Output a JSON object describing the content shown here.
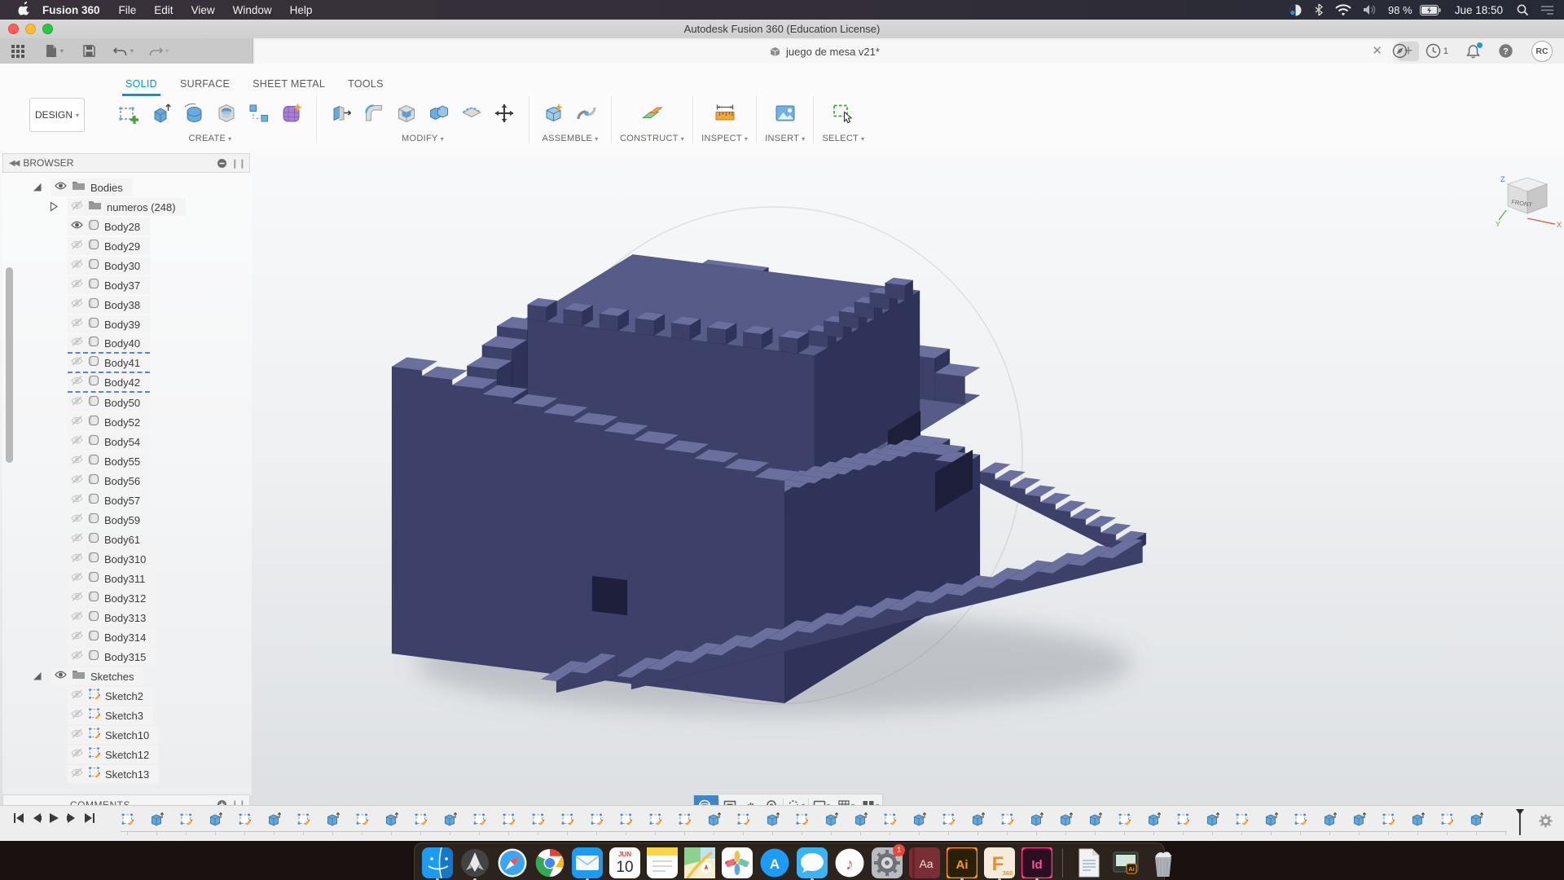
{
  "menu_bar": {
    "app_name": "Fusion 360",
    "items": [
      "File",
      "Edit",
      "View",
      "Window",
      "Help"
    ],
    "status_icons": [
      "display-toggle-icon",
      "bluetooth-icon",
      "wifi-icon",
      "volume-icon"
    ],
    "status": {
      "battery_pct": "98 %",
      "clock": "Jue 18:50"
    },
    "trailing_icons": [
      "spotlight-search-icon",
      "notification-center-icon"
    ]
  },
  "window_title": "Autodesk Fusion 360 (Education License)",
  "document_tab": {
    "title": "juego de mesa v21*"
  },
  "account": {
    "notification_count": "1",
    "avatar_initials": "RC"
  },
  "ribbon": {
    "workspace_label": "DESIGN",
    "tabs": [
      {
        "label": "SOLID",
        "active": true
      },
      {
        "label": "SURFACE",
        "active": false
      },
      {
        "label": "SHEET METAL",
        "active": false
      },
      {
        "label": "TOOLS",
        "active": false
      }
    ],
    "groups": [
      {
        "label": "CREATE",
        "tools": [
          "create-sketch",
          "extrude",
          "revolve",
          "hole",
          "rectangular-pattern",
          "create-form"
        ]
      },
      {
        "label": "MODIFY",
        "tools": [
          "press-pull",
          "fillet",
          "shell",
          "combine",
          "split-body",
          "move-copy"
        ]
      },
      {
        "label": "ASSEMBLE",
        "tools": [
          "new-component",
          "joint"
        ]
      },
      {
        "label": "CONSTRUCT",
        "tools": [
          "construction-plane"
        ]
      },
      {
        "label": "INSPECT",
        "tools": [
          "measure"
        ]
      },
      {
        "label": "INSERT",
        "tools": [
          "insert-image"
        ]
      },
      {
        "label": "SELECT",
        "tools": [
          "select"
        ]
      }
    ]
  },
  "browser": {
    "title": "BROWSER",
    "comments_label": "COMMENTS",
    "tree": [
      {
        "label": "Bodies",
        "type": "folder",
        "level": 1,
        "visible": true,
        "expanded": true
      },
      {
        "label": "numeros (248)",
        "type": "folder",
        "level": 2,
        "visible": false,
        "expanded": false
      },
      {
        "label": "Body28",
        "type": "body",
        "level": 2,
        "visible": true
      },
      {
        "label": "Body29",
        "type": "body",
        "level": 2,
        "visible": false
      },
      {
        "label": "Body30",
        "type": "body",
        "level": 2,
        "visible": false
      },
      {
        "label": "Body37",
        "type": "body",
        "level": 2,
        "visible": false
      },
      {
        "label": "Body38",
        "type": "body",
        "level": 2,
        "visible": false
      },
      {
        "label": "Body39",
        "type": "body",
        "level": 2,
        "visible": false
      },
      {
        "label": "Body40",
        "type": "body",
        "level": 2,
        "visible": false,
        "flagged": true
      },
      {
        "label": "Body41",
        "type": "body",
        "level": 2,
        "visible": false,
        "flagged": true
      },
      {
        "label": "Body42",
        "type": "body",
        "level": 2,
        "visible": false,
        "flagged": true
      },
      {
        "label": "Body50",
        "type": "body",
        "level": 2,
        "visible": false
      },
      {
        "label": "Body52",
        "type": "body",
        "level": 2,
        "visible": false
      },
      {
        "label": "Body54",
        "type": "body",
        "level": 2,
        "visible": false
      },
      {
        "label": "Body55",
        "type": "body",
        "level": 2,
        "visible": false
      },
      {
        "label": "Body56",
        "type": "body",
        "level": 2,
        "visible": false
      },
      {
        "label": "Body57",
        "type": "body",
        "level": 2,
        "visible": false
      },
      {
        "label": "Body59",
        "type": "body",
        "level": 2,
        "visible": false
      },
      {
        "label": "Body61",
        "type": "body",
        "level": 2,
        "visible": false
      },
      {
        "label": "Body310",
        "type": "body",
        "level": 2,
        "visible": false
      },
      {
        "label": "Body311",
        "type": "body",
        "level": 2,
        "visible": false
      },
      {
        "label": "Body312",
        "type": "body",
        "level": 2,
        "visible": false
      },
      {
        "label": "Body313",
        "type": "body",
        "level": 2,
        "visible": false
      },
      {
        "label": "Body314",
        "type": "body",
        "level": 2,
        "visible": false
      },
      {
        "label": "Body315",
        "type": "body",
        "level": 2,
        "visible": false
      },
      {
        "label": "Sketches",
        "type": "folder",
        "level": 1,
        "visible": true,
        "expanded": true
      },
      {
        "label": "Sketch2",
        "type": "sketch",
        "level": 2,
        "visible": false
      },
      {
        "label": "Sketch3",
        "type": "sketch",
        "level": 2,
        "visible": false
      },
      {
        "label": "Sketch10",
        "type": "sketch",
        "level": 2,
        "visible": false
      },
      {
        "label": "Sketch12",
        "type": "sketch",
        "level": 2,
        "visible": false
      },
      {
        "label": "Sketch13",
        "type": "sketch",
        "level": 2,
        "visible": false
      }
    ]
  },
  "viewcube": {
    "front_label": "FRONT",
    "axis_x": "X",
    "axis_y": "Y",
    "axis_z": "Z"
  },
  "view_toolbar": {
    "buttons": [
      "orbit",
      "look-at",
      "pan",
      "zoom",
      "fit",
      "display-settings",
      "grid-settings",
      "viewports"
    ]
  },
  "timeline": {
    "features": [
      "sketch",
      "extrude",
      "sketch",
      "extrude",
      "sketch",
      "extrude",
      "sketch",
      "extrude",
      "sketch",
      "extrude",
      "sketch",
      "extrude",
      "sketch",
      "sketch",
      "sketch",
      "sketch",
      "sketch",
      "sketch",
      "sketch",
      "sketch",
      "extrude",
      "sketch",
      "extrude",
      "sketch",
      "extrude",
      "extrude",
      "sketch",
      "extrude",
      "sketch",
      "extrude",
      "sketch",
      "extrude",
      "extrude",
      "extrude",
      "sketch",
      "extrude",
      "sketch",
      "extrude",
      "sketch",
      "extrude",
      "sketch",
      "extrude",
      "extrude",
      "sketch",
      "extrude",
      "sketch",
      "extrude"
    ]
  },
  "dock": {
    "items": [
      {
        "id": "finder",
        "running": true
      },
      {
        "id": "launchpad",
        "running": true
      },
      {
        "id": "safari"
      },
      {
        "id": "chrome"
      },
      {
        "id": "mail",
        "running": true
      },
      {
        "id": "calendar",
        "month": "JUN",
        "day": "10"
      },
      {
        "id": "notes"
      },
      {
        "id": "maps"
      },
      {
        "id": "photos"
      },
      {
        "id": "app-store",
        "glyph": "A"
      },
      {
        "id": "messages",
        "running": true
      },
      {
        "id": "music"
      },
      {
        "id": "system-preferences",
        "badge": "1"
      },
      {
        "id": "dictionary",
        "glyph": "Aa"
      },
      {
        "id": "illustrator",
        "glyph": "Ai",
        "running": true
      },
      {
        "id": "fusion-360",
        "glyph": "F",
        "sub": "360",
        "running": true
      },
      {
        "id": "indesign",
        "glyph": "Id",
        "running": true
      },
      {
        "id": "separator"
      },
      {
        "id": "document-file"
      },
      {
        "id": "ai-document",
        "glyph": "Ai"
      },
      {
        "id": "trash"
      }
    ]
  },
  "colors": {
    "accent_blue": "#0696d7",
    "selection_hatch": "#5b82d8",
    "badge_red": "#e5493a",
    "model": {
      "top": "#575b88",
      "top_light": "#6b6f9e",
      "face_front": "#3d4069",
      "face_right": "#2f3259",
      "hole": "#1d1f3a",
      "shadow": "rgba(120,126,138,0.35)"
    }
  }
}
